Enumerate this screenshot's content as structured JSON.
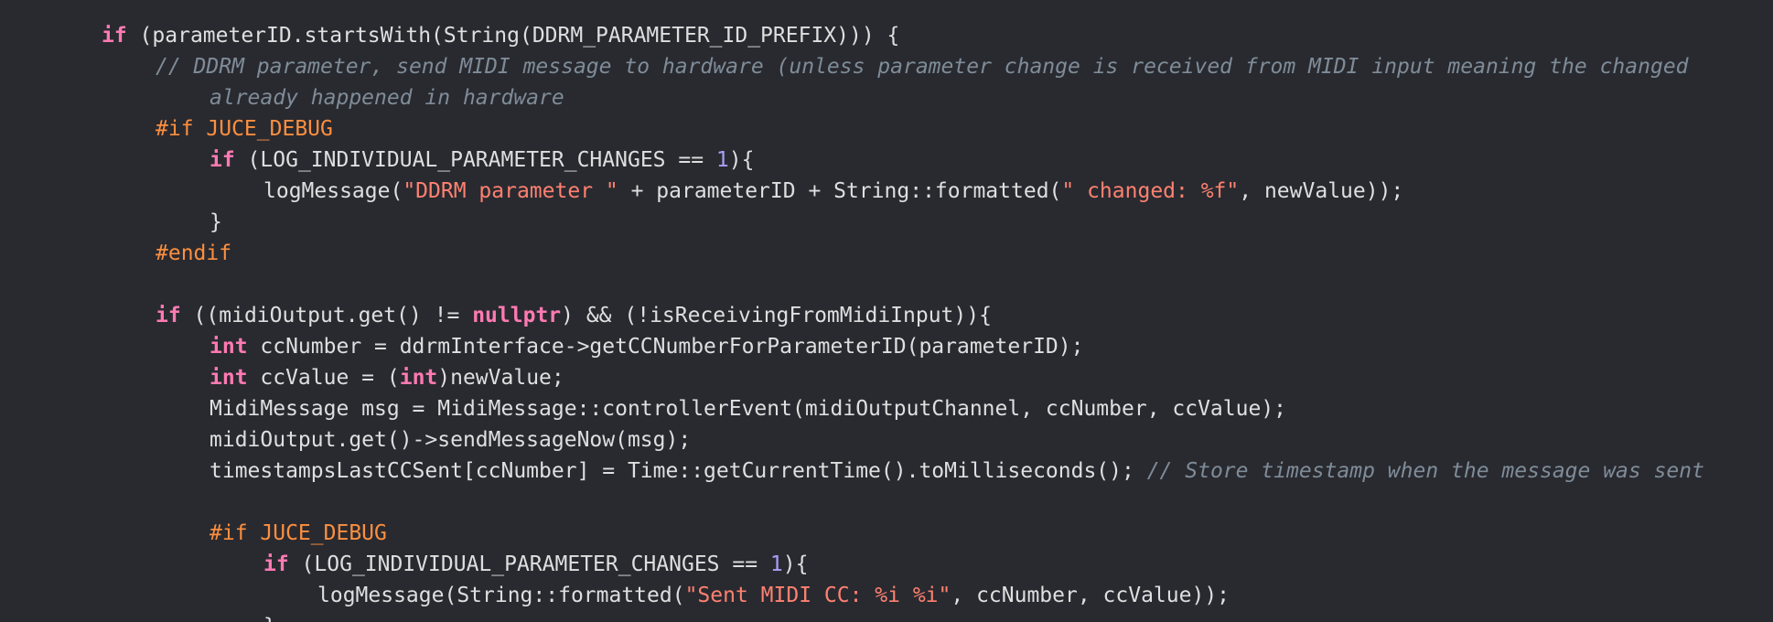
{
  "colors": {
    "background": "#292a30",
    "plain": "#dfdfe0",
    "keyword": "#ff7ab2",
    "preprocessor": "#fd8f3f",
    "string": "#ff8170",
    "number": "#a89ff7",
    "comment": "#7f8c98"
  },
  "lines": [
    {
      "indent": 1,
      "tokens": [
        {
          "t": "kw",
          "v": "if"
        },
        {
          "t": "plain",
          "v": " (parameterID.startsWith(String(DDRM_PARAMETER_ID_PREFIX))) {"
        }
      ]
    },
    {
      "indent": 2,
      "tokens": [
        {
          "t": "cmt",
          "v": "// DDRM parameter, send MIDI message to hardware (unless parameter change is received from MIDI input meaning the changed"
        }
      ]
    },
    {
      "indent": 3,
      "tokens": [
        {
          "t": "cmt",
          "v": "already happened in hardware"
        }
      ]
    },
    {
      "indent": 2,
      "tokens": [
        {
          "t": "pp",
          "v": "#if JUCE_DEBUG"
        }
      ]
    },
    {
      "indent": 3,
      "tokens": [
        {
          "t": "kw",
          "v": "if"
        },
        {
          "t": "plain",
          "v": " (LOG_INDIVIDUAL_PARAMETER_CHANGES == "
        },
        {
          "t": "num",
          "v": "1"
        },
        {
          "t": "plain",
          "v": "){"
        }
      ]
    },
    {
      "indent": 4,
      "tokens": [
        {
          "t": "plain",
          "v": "logMessage("
        },
        {
          "t": "str",
          "v": "\"DDRM parameter \""
        },
        {
          "t": "plain",
          "v": " + parameterID + String::formatted("
        },
        {
          "t": "str",
          "v": "\" changed: %f\""
        },
        {
          "t": "plain",
          "v": ", newValue));"
        }
      ]
    },
    {
      "indent": 3,
      "tokens": [
        {
          "t": "plain",
          "v": "}"
        }
      ]
    },
    {
      "indent": 2,
      "tokens": [
        {
          "t": "pp",
          "v": "#endif"
        }
      ]
    },
    {
      "indent": 0,
      "tokens": []
    },
    {
      "indent": 2,
      "tokens": [
        {
          "t": "kw",
          "v": "if"
        },
        {
          "t": "plain",
          "v": " ((midiOutput.get() != "
        },
        {
          "t": "kw",
          "v": "nullptr"
        },
        {
          "t": "plain",
          "v": ") && (!isReceivingFromMidiInput)){"
        }
      ]
    },
    {
      "indent": 3,
      "tokens": [
        {
          "t": "kw",
          "v": "int"
        },
        {
          "t": "plain",
          "v": " ccNumber = ddrmInterface->getCCNumberForParameterID(parameterID);"
        }
      ]
    },
    {
      "indent": 3,
      "tokens": [
        {
          "t": "kw",
          "v": "int"
        },
        {
          "t": "plain",
          "v": " ccValue = ("
        },
        {
          "t": "kw",
          "v": "int"
        },
        {
          "t": "plain",
          "v": ")newValue;"
        }
      ]
    },
    {
      "indent": 3,
      "tokens": [
        {
          "t": "plain",
          "v": "MidiMessage msg = MidiMessage::controllerEvent(midiOutputChannel, ccNumber, ccValue);"
        }
      ]
    },
    {
      "indent": 3,
      "tokens": [
        {
          "t": "plain",
          "v": "midiOutput.get()->sendMessageNow(msg);"
        }
      ]
    },
    {
      "indent": 3,
      "tokens": [
        {
          "t": "plain",
          "v": "timestampsLastCCSent[ccNumber] = Time::getCurrentTime().toMilliseconds(); "
        },
        {
          "t": "cmt",
          "v": "// Store timestamp when the message was sent"
        }
      ]
    },
    {
      "indent": 0,
      "tokens": []
    },
    {
      "indent": 3,
      "tokens": [
        {
          "t": "pp",
          "v": "#if JUCE_DEBUG"
        }
      ]
    },
    {
      "indent": 4,
      "tokens": [
        {
          "t": "kw",
          "v": "if"
        },
        {
          "t": "plain",
          "v": " (LOG_INDIVIDUAL_PARAMETER_CHANGES == "
        },
        {
          "t": "num",
          "v": "1"
        },
        {
          "t": "plain",
          "v": "){"
        }
      ]
    },
    {
      "indent": 5,
      "tokens": [
        {
          "t": "plain",
          "v": "logMessage(String::formatted("
        },
        {
          "t": "str",
          "v": "\"Sent MIDI CC: %i %i\""
        },
        {
          "t": "plain",
          "v": ", ccNumber, ccValue));"
        }
      ]
    },
    {
      "indent": 4,
      "tokens": [
        {
          "t": "plain",
          "v": "}"
        }
      ]
    }
  ]
}
